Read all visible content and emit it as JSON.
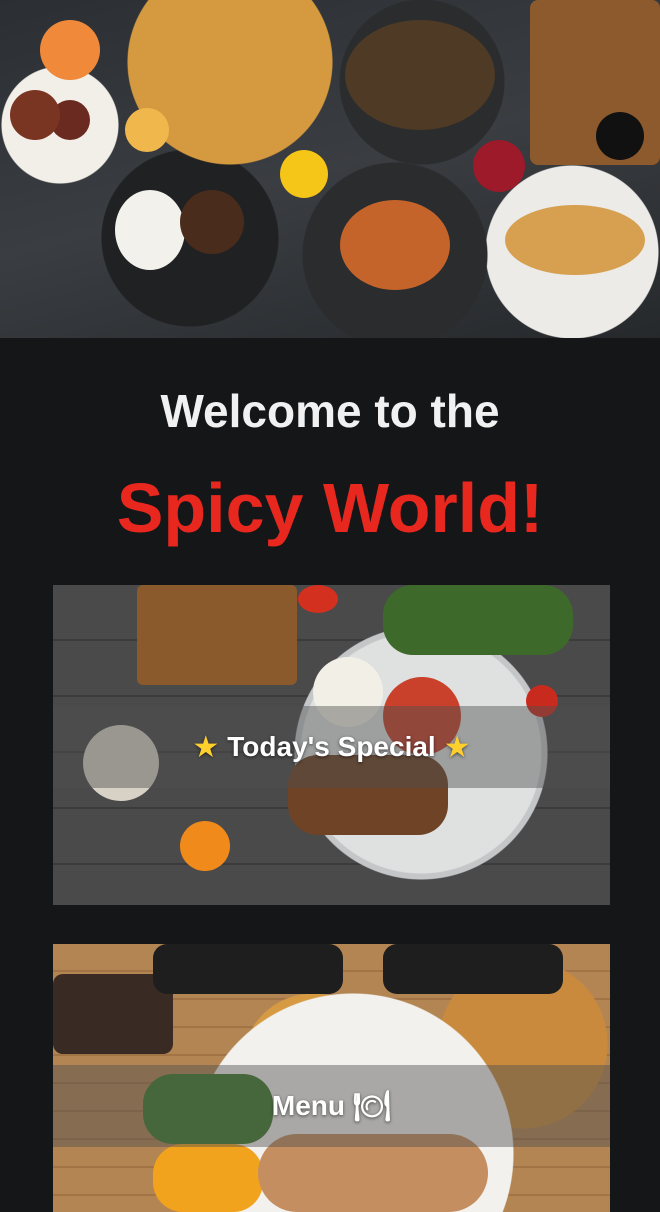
{
  "welcome": {
    "line1": "Welcome to the",
    "brand": "Spicy World!"
  },
  "cards": {
    "special": {
      "label": "Today's Special",
      "icon_left": "★",
      "icon_right": "★",
      "icon_name": "star-icon"
    },
    "menu": {
      "label": "Menu",
      "icon": "🍽",
      "icon_name": "plate-cutlery-icon"
    }
  },
  "colors": {
    "background": "#151618",
    "welcome_text": "#f1f1f1",
    "brand_red": "#e8281f",
    "star": "#ffcf2e"
  }
}
